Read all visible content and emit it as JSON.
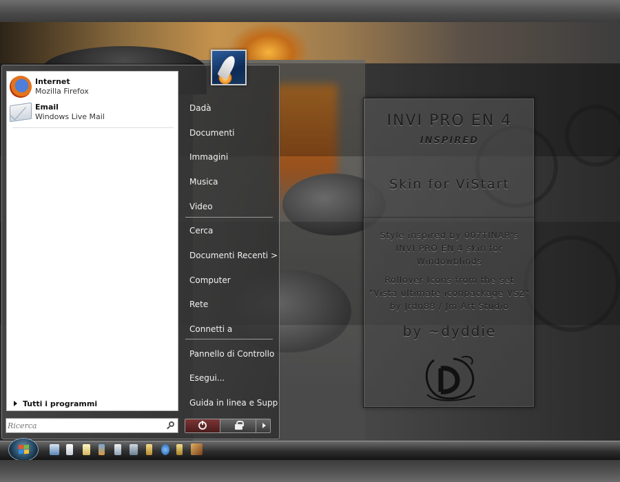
{
  "start_menu": {
    "pinned": [
      {
        "title": "Internet",
        "subtitle": "Mozilla Firefox",
        "icon": "firefox-icon"
      },
      {
        "title": "Email",
        "subtitle": "Windows Live Mail",
        "icon": "mail-icon"
      }
    ],
    "all_programs_label": "Tutti i programmi",
    "search_placeholder": "Ricerca",
    "right_items": [
      "Dadà",
      "Documenti",
      "Immagini",
      "Musica",
      "Video",
      "Cerca",
      "Documenti Recenti >",
      "Computer",
      "Rete",
      "Connetti a",
      "Pannello di Controllo",
      "Esegui...",
      "Guida in linea e Supp"
    ],
    "power_icons": [
      "power-icon",
      "lock-icon",
      "arrow-right-icon"
    ]
  },
  "info_panel": {
    "title": "INVI PRO EN 4",
    "subtitle": "INSPIRED",
    "skin_label": "Skin for ViStart",
    "credit_lines": [
      "Style inspired by 007TINAR's",
      "INVI PRO EN 4 skin for",
      "Windowblinds"
    ],
    "rollover_lines": [
      "Rollover Icons from the set",
      "\"Vista ultimate iconpackage VS2\"",
      "by Jrdn88 / Jm Art Studio"
    ],
    "author": "by ~dyddie"
  },
  "taskbar": {
    "quick_launch_icons": [
      "computer-icon",
      "document-icon",
      "notepad-icon",
      "paint-icon",
      "explorer-icon",
      "settings-icon",
      "folder-icon",
      "media-icon",
      "network-icon",
      "archive-icon",
      "game-icon"
    ]
  },
  "colors": {
    "menu_text": "#f2f2f2",
    "panel_text": "#1e1e1e",
    "power_button": "#7a3535"
  }
}
